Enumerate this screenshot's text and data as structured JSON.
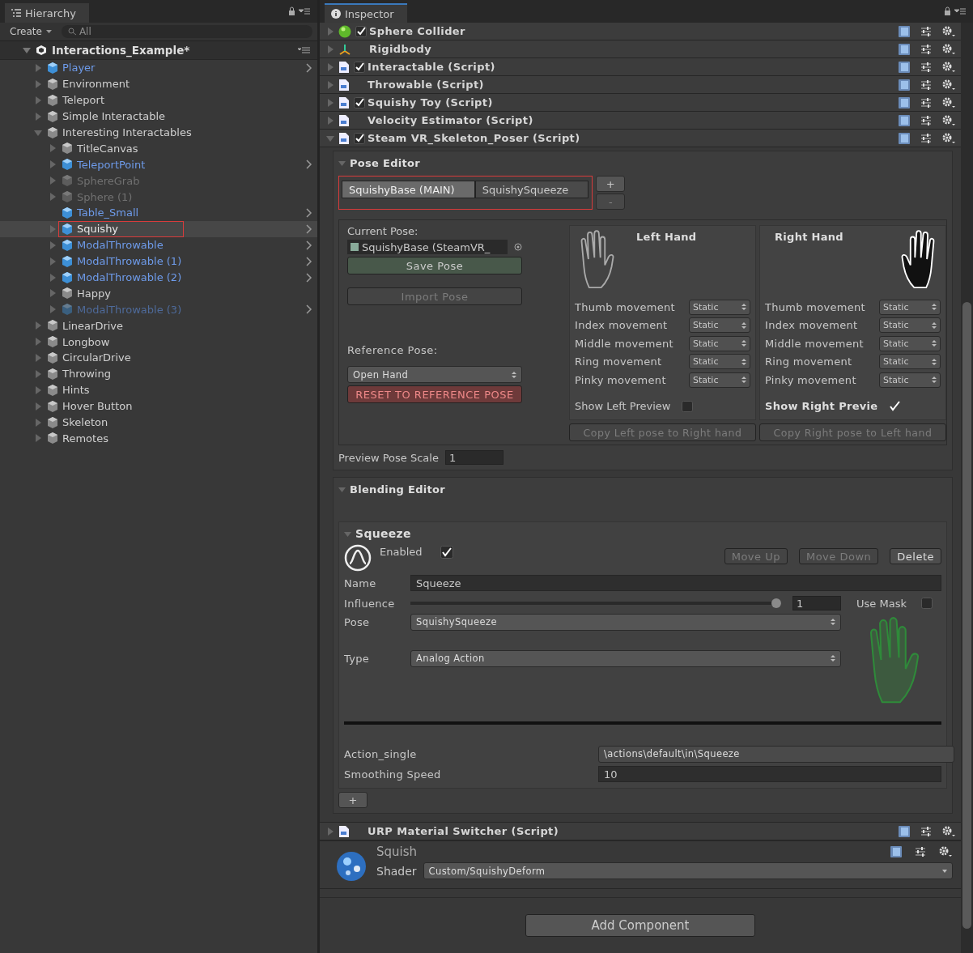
{
  "hierarchy": {
    "title": "Hierarchy",
    "create_label": "Create",
    "search_placeholder": "All",
    "scene": {
      "label": "Interactions_Example*",
      "expanded": true
    },
    "items": [
      {
        "label": "Player",
        "kind": "prefab",
        "active": true,
        "selected": false,
        "highlighted": false,
        "expandable": true,
        "expanded": false
      },
      {
        "label": "Environment",
        "kind": "object",
        "active": true,
        "selected": false,
        "highlighted": false,
        "expandable": true,
        "expanded": false
      },
      {
        "label": "Teleport",
        "kind": "object",
        "active": true,
        "selected": false,
        "highlighted": false,
        "expandable": true,
        "expanded": false
      },
      {
        "label": "Simple Interactable",
        "kind": "object",
        "active": true,
        "selected": false,
        "highlighted": false,
        "expandable": true,
        "expanded": false
      },
      {
        "label": "Interesting Interactables",
        "kind": "object",
        "active": true,
        "selected": false,
        "highlighted": false,
        "expandable": true,
        "expanded": true,
        "children": [
          {
            "label": "TitleCanvas",
            "kind": "object",
            "active": true,
            "selected": false,
            "highlighted": false,
            "expandable": true,
            "expanded": false
          },
          {
            "label": "TeleportPoint",
            "kind": "prefab",
            "active": true,
            "selected": false,
            "highlighted": false,
            "expandable": true,
            "expanded": false
          },
          {
            "label": "SphereGrab",
            "kind": "object",
            "active": false,
            "selected": false,
            "highlighted": false,
            "expandable": true,
            "expanded": false
          },
          {
            "label": "Sphere (1)",
            "kind": "object",
            "active": false,
            "selected": false,
            "highlighted": false,
            "expandable": true,
            "expanded": false
          },
          {
            "label": "Table_Small",
            "kind": "prefab",
            "active": true,
            "selected": false,
            "highlighted": false,
            "expandable": false,
            "expanded": false
          },
          {
            "label": "Squishy",
            "kind": "prefab",
            "active": true,
            "selected": true,
            "highlighted": true,
            "expandable": true,
            "expanded": false
          },
          {
            "label": "ModalThrowable",
            "kind": "prefab",
            "active": true,
            "selected": false,
            "highlighted": false,
            "expandable": true,
            "expanded": false
          },
          {
            "label": "ModalThrowable (1)",
            "kind": "prefab",
            "active": true,
            "selected": false,
            "highlighted": false,
            "expandable": true,
            "expanded": false
          },
          {
            "label": "ModalThrowable (2)",
            "kind": "prefab",
            "active": true,
            "selected": false,
            "highlighted": false,
            "expandable": true,
            "expanded": false
          },
          {
            "label": "Happy",
            "kind": "object",
            "active": true,
            "selected": false,
            "highlighted": false,
            "expandable": true,
            "expanded": false
          },
          {
            "label": "ModalThrowable (3)",
            "kind": "prefab",
            "active": false,
            "selected": false,
            "highlighted": false,
            "expandable": true,
            "expanded": false
          }
        ]
      },
      {
        "label": "LinearDrive",
        "kind": "object",
        "active": true,
        "selected": false,
        "highlighted": false,
        "expandable": true,
        "expanded": false
      },
      {
        "label": "Longbow",
        "kind": "object",
        "active": true,
        "selected": false,
        "highlighted": false,
        "expandable": true,
        "expanded": false
      },
      {
        "label": "CircularDrive",
        "kind": "object",
        "active": true,
        "selected": false,
        "highlighted": false,
        "expandable": true,
        "expanded": false
      },
      {
        "label": "Throwing",
        "kind": "object",
        "active": true,
        "selected": false,
        "highlighted": false,
        "expandable": true,
        "expanded": false
      },
      {
        "label": "Hints",
        "kind": "object",
        "active": true,
        "selected": false,
        "highlighted": false,
        "expandable": true,
        "expanded": false
      },
      {
        "label": "Hover Button",
        "kind": "object",
        "active": true,
        "selected": false,
        "highlighted": false,
        "expandable": true,
        "expanded": false
      },
      {
        "label": "Skeleton",
        "kind": "object",
        "active": true,
        "selected": false,
        "highlighted": false,
        "expandable": true,
        "expanded": false
      },
      {
        "label": "Remotes",
        "kind": "object",
        "active": true,
        "selected": false,
        "highlighted": false,
        "expandable": true,
        "expanded": false
      }
    ]
  },
  "inspector": {
    "title": "Inspector",
    "components": [
      {
        "name": "Sphere Collider",
        "kind": "collider",
        "toggle": true,
        "expanded": false
      },
      {
        "name": "Rigidbody",
        "kind": "rigidbody",
        "toggle": false,
        "expanded": false
      },
      {
        "name": "Interactable (Script)",
        "kind": "script",
        "toggle": true,
        "expanded": false
      },
      {
        "name": "Throwable (Script)",
        "kind": "script",
        "toggle": false,
        "expanded": false
      },
      {
        "name": "Squishy Toy (Script)",
        "kind": "script",
        "toggle": true,
        "expanded": false
      },
      {
        "name": "Velocity Estimator (Script)",
        "kind": "script",
        "toggle": false,
        "expanded": false
      },
      {
        "name": "Steam VR_Skeleton_Poser (Script)",
        "kind": "script",
        "toggle": true,
        "expanded": true
      },
      {
        "name": "URP Material Switcher (Script)",
        "kind": "script",
        "toggle": false,
        "expanded": false
      }
    ],
    "pose_editor": {
      "title": "Pose Editor",
      "highlighted": true,
      "pose_tabs": [
        {
          "label": "SquishyBase (MAIN)",
          "selected": true
        },
        {
          "label": "SquishySqueeze",
          "selected": false
        }
      ],
      "add_label": "+",
      "remove_label": "-",
      "current_pose_label": "Current Pose:",
      "current_pose_value": "SquishyBase (SteamVR_",
      "save_label": "Save Pose",
      "import_label": "Import Pose",
      "reference_pose_label": "Reference Pose:",
      "reference_pose_value": "Open Hand",
      "reset_label": "RESET TO REFERENCE POSE",
      "hands": [
        {
          "title": "Left Hand",
          "kind": "left",
          "fingers": [
            {
              "label": "Thumb movement",
              "value": "Static"
            },
            {
              "label": "Index movement",
              "value": "Static"
            },
            {
              "label": "Middle movement",
              "value": "Static"
            },
            {
              "label": "Ring movement",
              "value": "Static"
            },
            {
              "label": "Pinky movement",
              "value": "Static"
            }
          ],
          "preview_label": "Show Left Preview",
          "preview": false,
          "copy_label": "Copy Left pose to Right hand"
        },
        {
          "title": "Right Hand",
          "kind": "right",
          "fingers": [
            {
              "label": "Thumb movement",
              "value": "Static"
            },
            {
              "label": "Index movement",
              "value": "Static"
            },
            {
              "label": "Middle movement",
              "value": "Static"
            },
            {
              "label": "Ring movement",
              "value": "Static"
            },
            {
              "label": "Pinky movement",
              "value": "Static"
            }
          ],
          "preview_label": "Show Right Previe",
          "preview": true,
          "copy_label": "Copy Right pose to Left hand"
        }
      ],
      "scale_label": "Preview Pose Scale",
      "scale_value": "1"
    },
    "blending_editor": {
      "title": "Blending Editor",
      "add_label": "+",
      "behaviours": [
        {
          "title": "Squeeze",
          "enabled_label": "Enabled",
          "enabled": true,
          "move_up": "Move Up",
          "move_down": "Move Down",
          "delete": "Delete",
          "name_label": "Name",
          "name_value": "Squeeze",
          "influence_label": "Influence",
          "level": 1,
          "influence_value": "1",
          "mask_label": "Use Mask",
          "use_mask": false,
          "pose_label": "Pose",
          "pose_value": "SquishySqueeze",
          "type_label": "Type",
          "type_value": "Analog Action",
          "action_label": "Action_single",
          "action_value": "\\actions\\default\\in\\Squeeze",
          "smoothing_label": "Smoothing Speed",
          "smoothing_value": "10"
        }
      ]
    },
    "material": {
      "name": "Squish",
      "shader_label": "Shader",
      "shader_value": "Custom/SquishyDeform"
    },
    "add_component": "Add Component"
  }
}
